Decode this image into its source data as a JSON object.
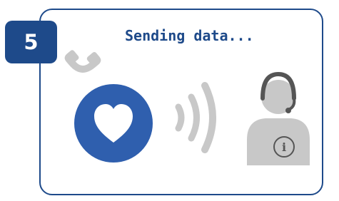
{
  "step": {
    "number": "5"
  },
  "title": "Sending data...",
  "colors": {
    "brand_blue": "#1e4a8a",
    "heart_blue": "#2f5fae",
    "gray": "#c8c8c8",
    "dark_gray": "#555555"
  },
  "icons": [
    "phone-icon",
    "heart-icon",
    "signal-waves-icon",
    "support-agent-icon",
    "info-icon"
  ],
  "info_glyph": "i"
}
